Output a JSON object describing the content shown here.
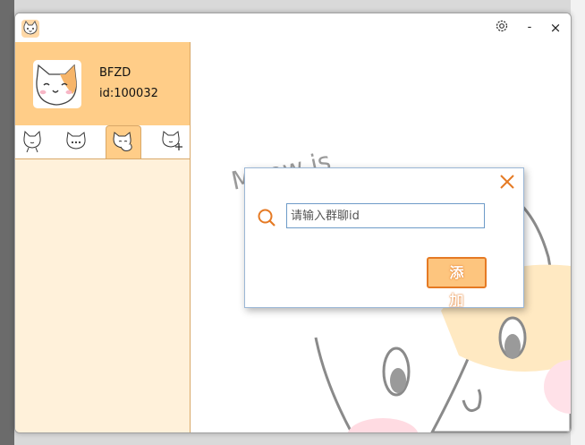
{
  "profile": {
    "username": "BFZD",
    "user_id": "id:100032"
  },
  "titlebar": {
    "minimize_label": "-",
    "close_label": "×"
  },
  "background_doodle": {
    "text": "Meow is"
  },
  "dialog": {
    "input_placeholder": "请输入群聊id",
    "add_button_label": "添 加",
    "close_label": "×"
  },
  "colors": {
    "profile_bg": "#ffcd88",
    "sidebar_bg": "#fff1da",
    "accent_orange": "#e57a24",
    "button_fill": "#fdc57e"
  },
  "icons": {
    "app": "cat-face-icon",
    "settings": "gear-icon",
    "tabs": [
      "cat-icon",
      "cat-chat-icon",
      "cat-group-icon",
      "cat-add-icon"
    ],
    "search": "search-icon",
    "close": "close-icon"
  }
}
